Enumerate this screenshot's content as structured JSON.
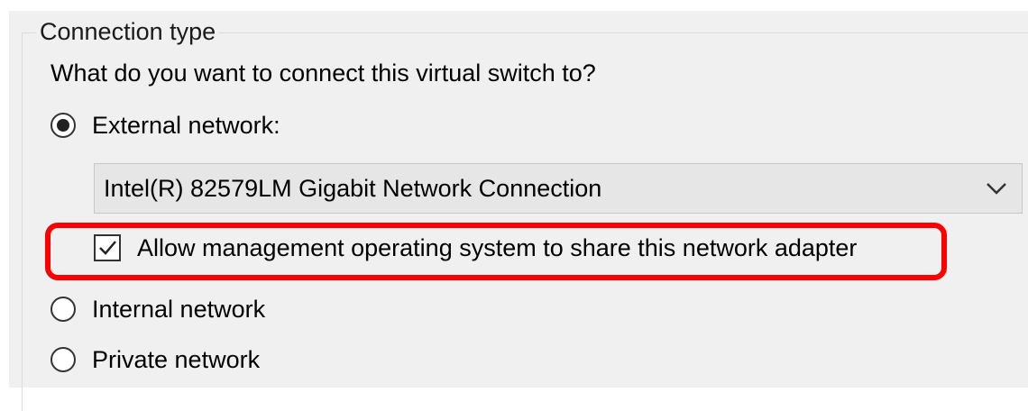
{
  "group": {
    "legend": "Connection type",
    "question": "What do you want to connect this virtual switch to?"
  },
  "options": {
    "external": {
      "label": "External network:",
      "selected": true
    },
    "internal": {
      "label": "Internal network",
      "selected": false
    },
    "private": {
      "label": "Private network",
      "selected": false
    }
  },
  "adapter_dropdown": {
    "selected_value": "Intel(R) 82579LM Gigabit Network Connection",
    "chevron_icon": "chevron-down-icon"
  },
  "management_checkbox": {
    "label": "Allow management operating system to share this network adapter",
    "checked": true,
    "highlight_color": "#ff0000"
  }
}
